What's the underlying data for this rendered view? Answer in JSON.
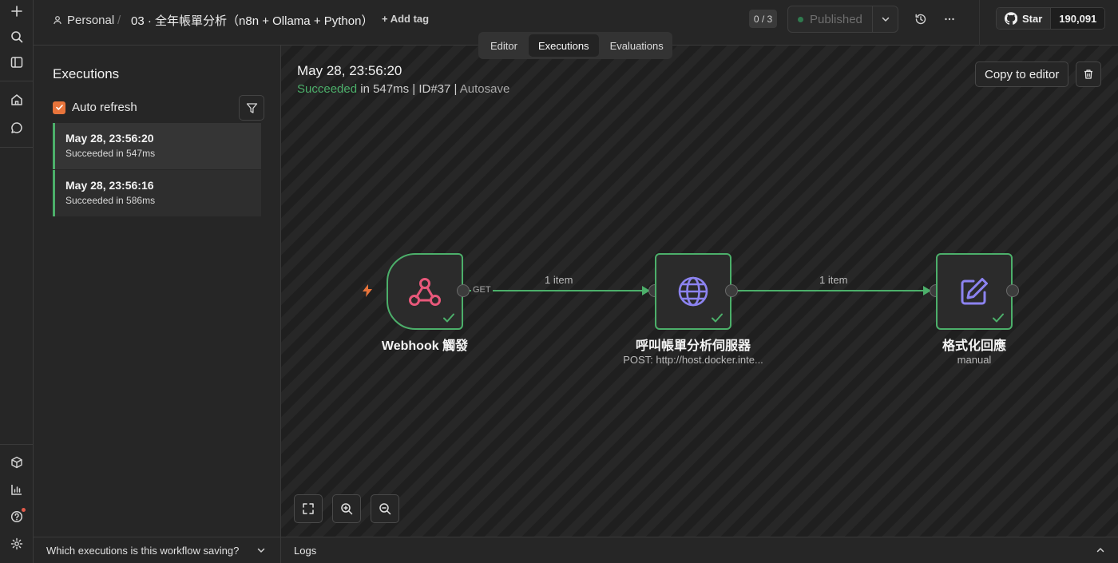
{
  "header": {
    "project": "Personal",
    "separator": "/",
    "workflow_title": "03 · 全年帳單分析（n8n + Ollama + Python）",
    "add_tag": "+ Add tag",
    "counter": "0 / 3",
    "publish_label": "Published",
    "github_star": "Star",
    "github_count": "190,091"
  },
  "tabs": [
    {
      "label": "Editor",
      "active": false
    },
    {
      "label": "Executions",
      "active": true
    },
    {
      "label": "Evaluations",
      "active": false
    }
  ],
  "executions_panel": {
    "title": "Executions",
    "auto_refresh_label": "Auto refresh",
    "auto_refresh_checked": true,
    "items": [
      {
        "time": "May 28, 23:56:20",
        "status": "Succeeded in 547ms",
        "selected": true
      },
      {
        "time": "May 28, 23:56:16",
        "status": "Succeeded in 586ms",
        "selected": false
      }
    ],
    "footer_question": "Which executions is this workflow saving?"
  },
  "execution_detail": {
    "title": "May 28, 23:56:20",
    "status_word": "Succeeded",
    "status_rest": " in 547ms | ID#37 | ",
    "mode": "Autosave",
    "copy_button": "Copy to editor"
  },
  "workflow": {
    "nodes": [
      {
        "name": "Webhook 觸發",
        "subtitle": "",
        "icon": "webhook-icon",
        "status": "success"
      },
      {
        "name": "呼叫帳單分析伺服器",
        "subtitle": "POST: http://host.docker.inte...",
        "icon": "globe-icon",
        "status": "success"
      },
      {
        "name": "格式化回應",
        "subtitle": "manual",
        "icon": "edit-icon",
        "status": "success"
      }
    ],
    "edges": [
      {
        "from": "Webhook 觸發",
        "to": "呼叫帳單分析伺服器",
        "label": "1 item",
        "method": "GET"
      },
      {
        "from": "呼叫帳單分析伺服器",
        "to": "格式化回應",
        "label": "1 item"
      }
    ]
  },
  "logs_label": "Logs",
  "colors": {
    "success": "#4caf6a",
    "accent": "#e8743b",
    "node_icon_webhook": "#e8587a",
    "node_icon_http": "#8c83f0",
    "node_icon_edit": "#8c83f0"
  }
}
